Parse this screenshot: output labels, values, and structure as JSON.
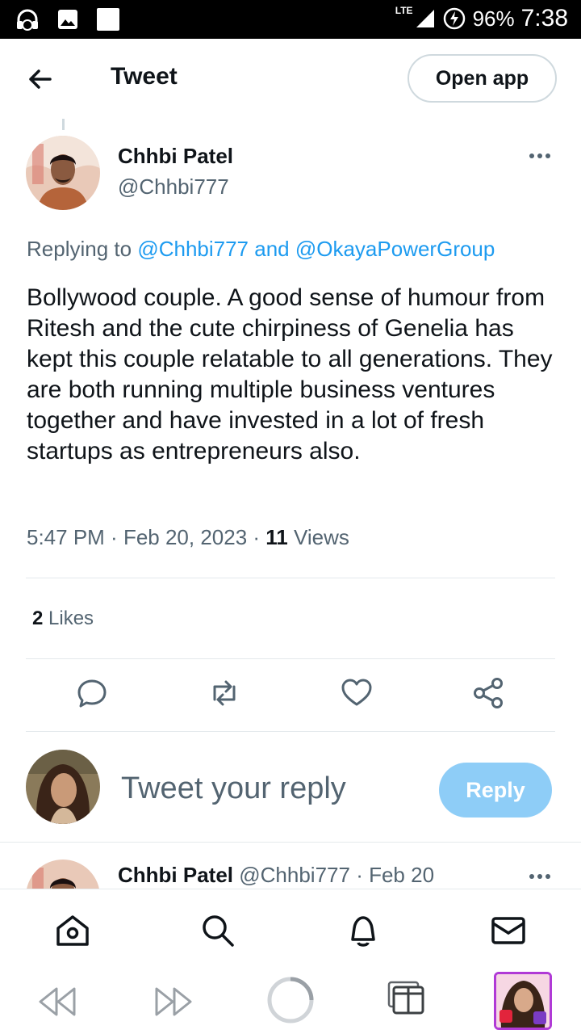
{
  "status_bar": {
    "network": "LTE",
    "battery": "96%",
    "time": "7:38",
    "left_icons": [
      "headset-icon",
      "image-icon",
      "square-icon"
    ]
  },
  "header": {
    "title": "Tweet",
    "open_app_label": "Open app"
  },
  "tweet": {
    "author_name": "Chhbi Patel",
    "author_handle": "@Chhbi777",
    "replying_prefix": "Replying to ",
    "replying_handle_1": "@Chhbi777",
    "replying_joiner": " and ",
    "replying_handle_2": "@OkayaPowerGroup",
    "text": "Bollywood couple. A good sense of humour from Ritesh and the cute chirpiness of Genelia has kept this couple relatable to all generations. They are both running multiple business ventures together and have invested in a lot of fresh startups as entrepreneurs also.",
    "time": "5:47 PM",
    "date": "Feb 20, 2023",
    "views_count": "11",
    "views_label": "Views",
    "likes_count": "2",
    "likes_label": "Likes"
  },
  "actions": [
    "reply-icon",
    "retweet-icon",
    "like-icon",
    "share-icon"
  ],
  "composer": {
    "placeholder": "Tweet your reply",
    "reply_label": "Reply"
  },
  "next_reply": {
    "author_name": "Chhbi Patel",
    "author_handle": "@Chhbi777",
    "date": "Feb 20"
  },
  "bottom_nav": [
    "home-icon",
    "search-icon",
    "notifications-icon",
    "messages-icon"
  ],
  "browser_bar": [
    "back-arrow-icon",
    "forward-arrow-icon",
    "loading-icon",
    "tabs-icon",
    "profile-avatar"
  ],
  "colors": {
    "accent": "#1d9bf0",
    "reply_button": "#8ecdf7",
    "muted_text": "#536471",
    "divider": "#e4e9ec"
  }
}
